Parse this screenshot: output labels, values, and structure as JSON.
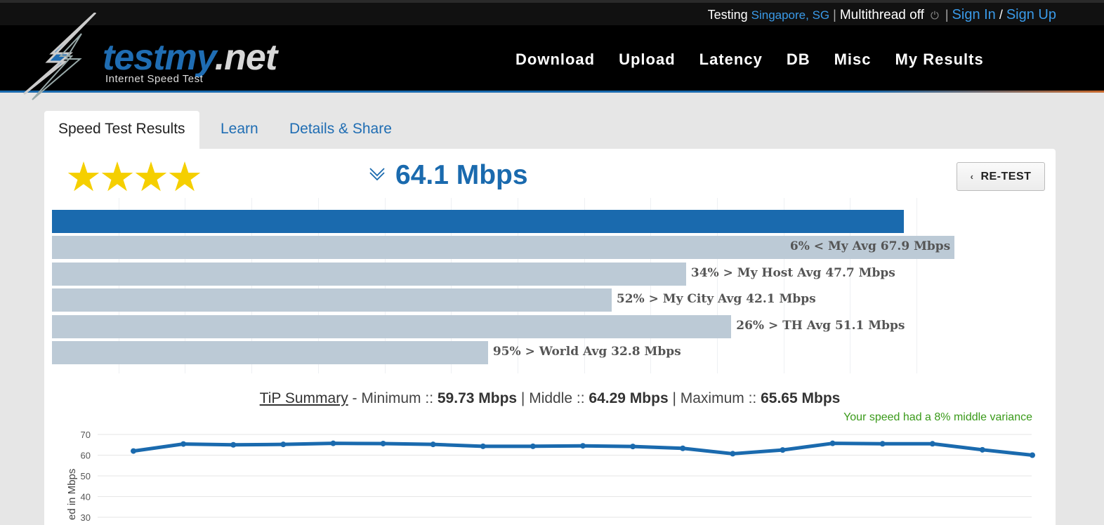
{
  "topbar": {
    "testing_label": "Testing",
    "location": "Singapore, SG",
    "separator": "|",
    "multithread": "Multithread off",
    "power_icon": "power-icon",
    "sign_in": "Sign In",
    "slash": "/",
    "sign_up": "Sign Up"
  },
  "header": {
    "logo_main": "testmy",
    "logo_net": ".net",
    "logo_sub": "Internet Speed Test",
    "nav": [
      "Download",
      "Upload",
      "Latency",
      "DB",
      "Misc",
      "My Results"
    ]
  },
  "tabs": [
    "Speed Test Results",
    "Learn",
    "Details & Share"
  ],
  "result": {
    "stars": 4,
    "stars_max": 4,
    "speed": "64.1 Mbps",
    "retest_label": "RE-TEST",
    "retest_icon": "chevron-left-icon",
    "speed_icon": "download-arrow-icon"
  },
  "comparison": {
    "main_value": 64.1,
    "scale_max": 70,
    "items": [
      {
        "label": "6% < My Avg 67.9 Mbps",
        "value": 67.9,
        "label_inside": true
      },
      {
        "label": "34% > My Host Avg 47.7 Mbps",
        "value": 47.7,
        "label_inside": false
      },
      {
        "label": "52% > My City Avg 42.1 Mbps",
        "value": 42.1,
        "label_inside": false
      },
      {
        "label": "26% > TH Avg 51.1 Mbps",
        "value": 51.1,
        "label_inside": false
      },
      {
        "label": "95% > World Avg 32.8 Mbps",
        "value": 32.8,
        "label_inside": false
      }
    ]
  },
  "tip": {
    "title": "TiP Summary",
    "min_label": " - Minimum :: ",
    "min": "59.73 Mbps",
    "mid_label": " | Middle :: ",
    "mid": "64.29 Mbps",
    "max_label": " | Maximum :: ",
    "max": "65.65 Mbps",
    "variance": "Your speed had a 8% middle variance"
  },
  "chart_data": {
    "type": "line",
    "title": "",
    "xlabel": "",
    "ylabel": "ed in Mbps",
    "ylim": [
      30,
      70
    ],
    "yticks": [
      70,
      60,
      50,
      40,
      30
    ],
    "grid": true,
    "series": [
      {
        "color": "#1a6aae",
        "values": [
          62,
          65.4,
          65,
          65.2,
          65.7,
          65.6,
          65.2,
          64.3,
          64.3,
          64.5,
          64.2,
          63.3,
          60.7,
          62.5,
          65.7,
          65.5,
          65.5,
          62.6,
          60
        ]
      }
    ]
  },
  "colors": {
    "accent": "#1a6aae",
    "bar_compare": "#bccad6",
    "star": "#f5cf00",
    "variance": "#3a9a1a"
  }
}
